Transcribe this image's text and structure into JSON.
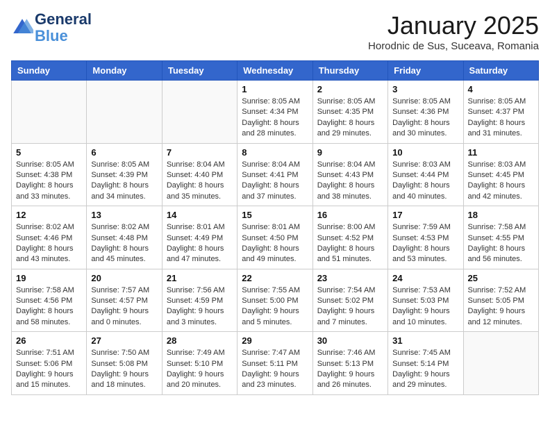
{
  "header": {
    "logo_line1": "General",
    "logo_line2": "Blue",
    "month": "January 2025",
    "location": "Horodnic de Sus, Suceava, Romania"
  },
  "weekdays": [
    "Sunday",
    "Monday",
    "Tuesday",
    "Wednesday",
    "Thursday",
    "Friday",
    "Saturday"
  ],
  "weeks": [
    [
      {
        "day": "",
        "info": ""
      },
      {
        "day": "",
        "info": ""
      },
      {
        "day": "",
        "info": ""
      },
      {
        "day": "1",
        "info": "Sunrise: 8:05 AM\nSunset: 4:34 PM\nDaylight: 8 hours and 28 minutes."
      },
      {
        "day": "2",
        "info": "Sunrise: 8:05 AM\nSunset: 4:35 PM\nDaylight: 8 hours and 29 minutes."
      },
      {
        "day": "3",
        "info": "Sunrise: 8:05 AM\nSunset: 4:36 PM\nDaylight: 8 hours and 30 minutes."
      },
      {
        "day": "4",
        "info": "Sunrise: 8:05 AM\nSunset: 4:37 PM\nDaylight: 8 hours and 31 minutes."
      }
    ],
    [
      {
        "day": "5",
        "info": "Sunrise: 8:05 AM\nSunset: 4:38 PM\nDaylight: 8 hours and 33 minutes."
      },
      {
        "day": "6",
        "info": "Sunrise: 8:05 AM\nSunset: 4:39 PM\nDaylight: 8 hours and 34 minutes."
      },
      {
        "day": "7",
        "info": "Sunrise: 8:04 AM\nSunset: 4:40 PM\nDaylight: 8 hours and 35 minutes."
      },
      {
        "day": "8",
        "info": "Sunrise: 8:04 AM\nSunset: 4:41 PM\nDaylight: 8 hours and 37 minutes."
      },
      {
        "day": "9",
        "info": "Sunrise: 8:04 AM\nSunset: 4:43 PM\nDaylight: 8 hours and 38 minutes."
      },
      {
        "day": "10",
        "info": "Sunrise: 8:03 AM\nSunset: 4:44 PM\nDaylight: 8 hours and 40 minutes."
      },
      {
        "day": "11",
        "info": "Sunrise: 8:03 AM\nSunset: 4:45 PM\nDaylight: 8 hours and 42 minutes."
      }
    ],
    [
      {
        "day": "12",
        "info": "Sunrise: 8:02 AM\nSunset: 4:46 PM\nDaylight: 8 hours and 43 minutes."
      },
      {
        "day": "13",
        "info": "Sunrise: 8:02 AM\nSunset: 4:48 PM\nDaylight: 8 hours and 45 minutes."
      },
      {
        "day": "14",
        "info": "Sunrise: 8:01 AM\nSunset: 4:49 PM\nDaylight: 8 hours and 47 minutes."
      },
      {
        "day": "15",
        "info": "Sunrise: 8:01 AM\nSunset: 4:50 PM\nDaylight: 8 hours and 49 minutes."
      },
      {
        "day": "16",
        "info": "Sunrise: 8:00 AM\nSunset: 4:52 PM\nDaylight: 8 hours and 51 minutes."
      },
      {
        "day": "17",
        "info": "Sunrise: 7:59 AM\nSunset: 4:53 PM\nDaylight: 8 hours and 53 minutes."
      },
      {
        "day": "18",
        "info": "Sunrise: 7:58 AM\nSunset: 4:55 PM\nDaylight: 8 hours and 56 minutes."
      }
    ],
    [
      {
        "day": "19",
        "info": "Sunrise: 7:58 AM\nSunset: 4:56 PM\nDaylight: 8 hours and 58 minutes."
      },
      {
        "day": "20",
        "info": "Sunrise: 7:57 AM\nSunset: 4:57 PM\nDaylight: 9 hours and 0 minutes."
      },
      {
        "day": "21",
        "info": "Sunrise: 7:56 AM\nSunset: 4:59 PM\nDaylight: 9 hours and 3 minutes."
      },
      {
        "day": "22",
        "info": "Sunrise: 7:55 AM\nSunset: 5:00 PM\nDaylight: 9 hours and 5 minutes."
      },
      {
        "day": "23",
        "info": "Sunrise: 7:54 AM\nSunset: 5:02 PM\nDaylight: 9 hours and 7 minutes."
      },
      {
        "day": "24",
        "info": "Sunrise: 7:53 AM\nSunset: 5:03 PM\nDaylight: 9 hours and 10 minutes."
      },
      {
        "day": "25",
        "info": "Sunrise: 7:52 AM\nSunset: 5:05 PM\nDaylight: 9 hours and 12 minutes."
      }
    ],
    [
      {
        "day": "26",
        "info": "Sunrise: 7:51 AM\nSunset: 5:06 PM\nDaylight: 9 hours and 15 minutes."
      },
      {
        "day": "27",
        "info": "Sunrise: 7:50 AM\nSunset: 5:08 PM\nDaylight: 9 hours and 18 minutes."
      },
      {
        "day": "28",
        "info": "Sunrise: 7:49 AM\nSunset: 5:10 PM\nDaylight: 9 hours and 20 minutes."
      },
      {
        "day": "29",
        "info": "Sunrise: 7:47 AM\nSunset: 5:11 PM\nDaylight: 9 hours and 23 minutes."
      },
      {
        "day": "30",
        "info": "Sunrise: 7:46 AM\nSunset: 5:13 PM\nDaylight: 9 hours and 26 minutes."
      },
      {
        "day": "31",
        "info": "Sunrise: 7:45 AM\nSunset: 5:14 PM\nDaylight: 9 hours and 29 minutes."
      },
      {
        "day": "",
        "info": ""
      }
    ]
  ]
}
